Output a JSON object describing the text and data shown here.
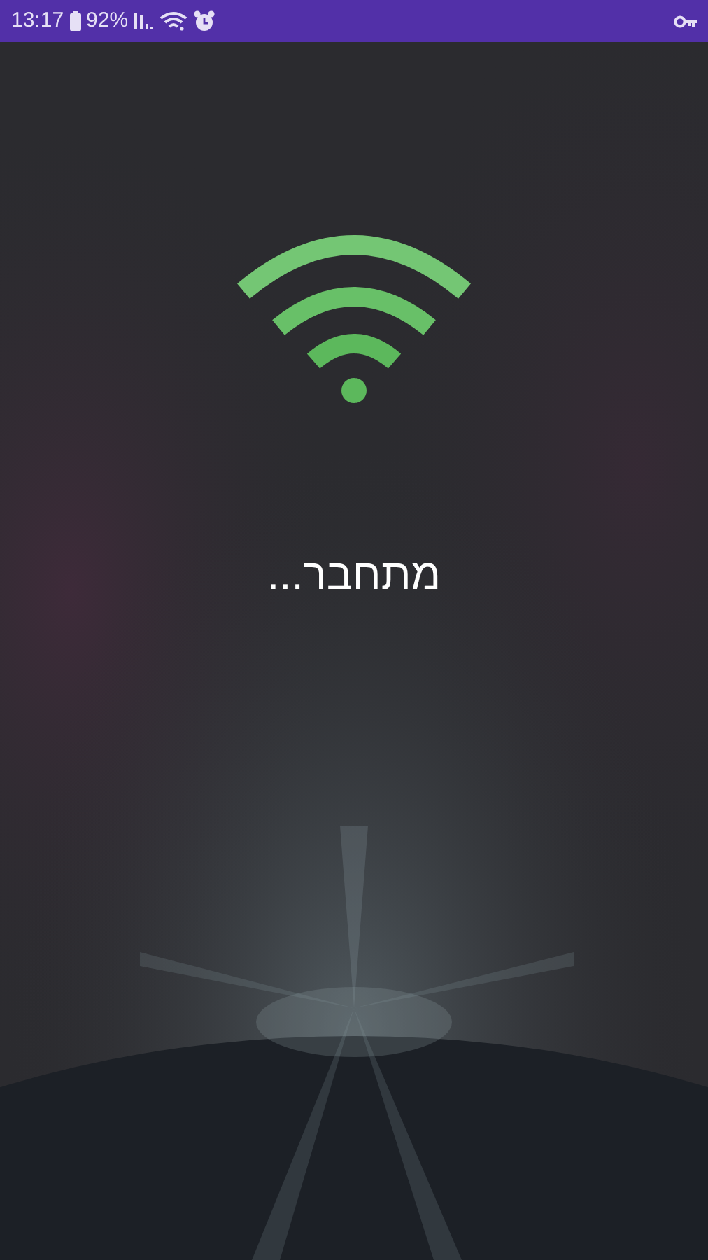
{
  "status_bar": {
    "time": "13:17",
    "battery": "92%"
  },
  "message": "מתחבר..."
}
